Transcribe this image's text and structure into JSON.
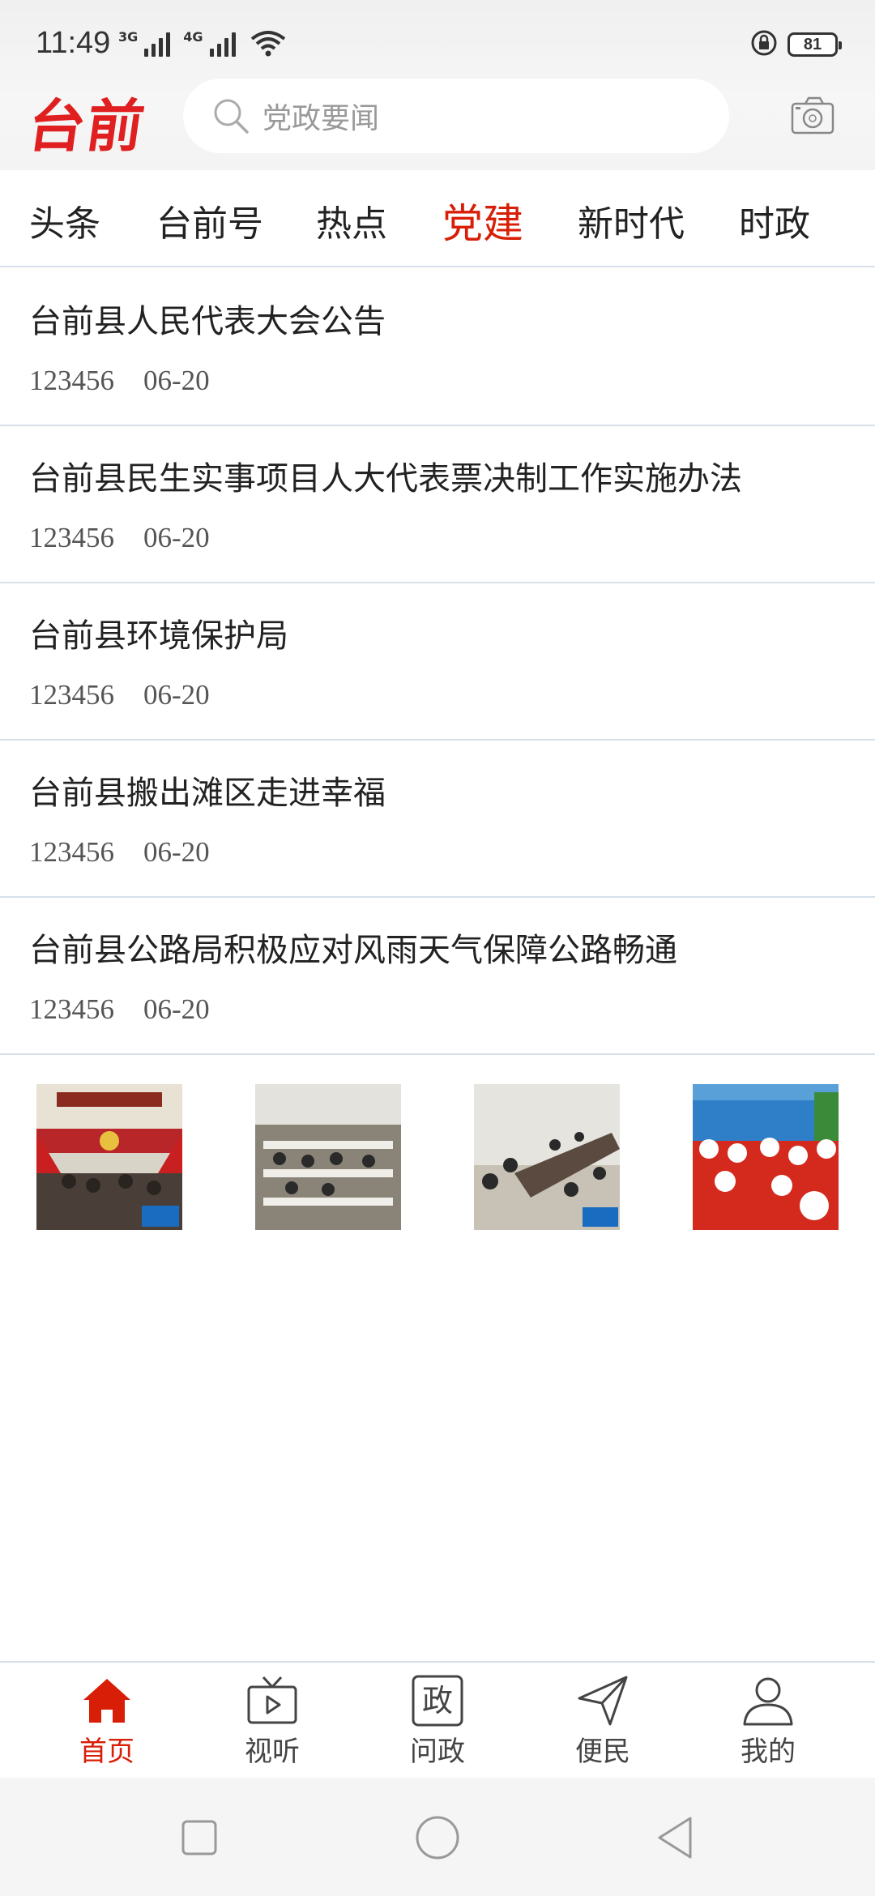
{
  "status_bar": {
    "time": "11:49",
    "network1": "3G",
    "network2": "4G",
    "battery": "81"
  },
  "header": {
    "logo": "台前",
    "search_placeholder": "党政要闻"
  },
  "tabs": [
    {
      "label": "头条",
      "active": false
    },
    {
      "label": "台前号",
      "active": false
    },
    {
      "label": "热点",
      "active": false
    },
    {
      "label": "党建",
      "active": true
    },
    {
      "label": "新时代",
      "active": false
    },
    {
      "label": "时政",
      "active": false
    }
  ],
  "news": [
    {
      "title": "台前县人民代表大会公告",
      "source": "123456",
      "date": "06-20"
    },
    {
      "title": "台前县民生实事项目人大代表票决制工作实施办法",
      "source": "123456",
      "date": "06-20"
    },
    {
      "title": "台前县环境保护局",
      "source": "123456",
      "date": "06-20"
    },
    {
      "title": "台前县搬出滩区走进幸福",
      "source": "123456",
      "date": "06-20"
    },
    {
      "title": "台前县公路局积极应对风雨天气保障公路畅通",
      "source": "123456",
      "date": "06-20"
    }
  ],
  "bottom_nav": [
    {
      "label": "首页",
      "icon": "home-icon",
      "active": true
    },
    {
      "label": "视听",
      "icon": "tv-icon",
      "active": false
    },
    {
      "label": "问政",
      "icon": "zheng-icon",
      "icon_text": "政",
      "active": false
    },
    {
      "label": "便民",
      "icon": "send-icon",
      "active": false
    },
    {
      "label": "我的",
      "icon": "user-icon",
      "active": false
    }
  ],
  "colors": {
    "accent": "#d81e06",
    "logo": "#e02020",
    "divider": "#d6e0ea"
  }
}
